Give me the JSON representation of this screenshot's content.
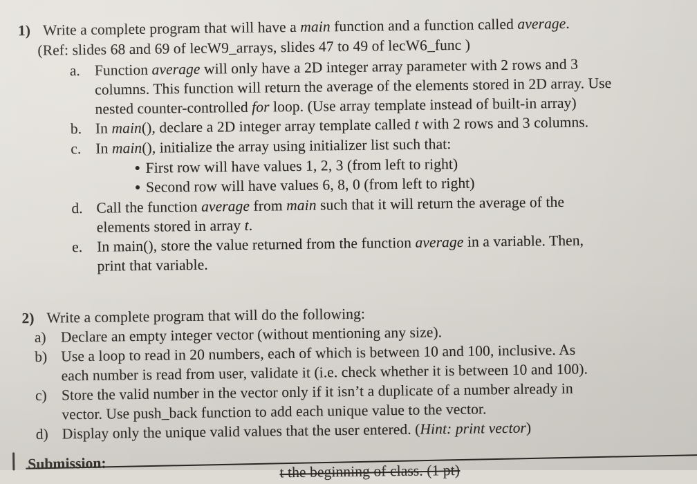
{
  "document": {
    "type": "printed-assignment-sheet",
    "paper_color": "#dedbd5",
    "ink_color": "#231f1d",
    "questions": [
      {
        "number": "1)",
        "lines": [
          {
            "text_before": "Write a complete program that will have a ",
            "italic": "main",
            "text_mid": " function and a function called ",
            "italic2": "average",
            "text_after": "."
          },
          {
            "text": "(Ref: slides 68 and 69 of lecW9_arrays, slides 47 to 49 of lecW6_func )"
          }
        ],
        "items": [
          {
            "marker": "a.",
            "lines": [
              {
                "pre": "Function ",
                "em": "average",
                "post": " will only have a 2D integer array parameter with 2 rows and 3"
              },
              {
                "pre": "columns. This function will return the average of the elements stored in 2D array. Use"
              },
              {
                "pre": "nested counter-controlled ",
                "em": "for",
                "post": " loop. (Use array template instead of built-in array)"
              }
            ]
          },
          {
            "marker": "b.",
            "lines": [
              {
                "pre": "In ",
                "em": "main",
                "post": "(), declare a 2D integer array template called ",
                "em2": "t",
                "post2": " with 2 rows and 3 columns."
              }
            ]
          },
          {
            "marker": "c.",
            "lines": [
              {
                "pre": "In ",
                "em": "main",
                "post": "(), initialize the array using initializer list such that:"
              }
            ],
            "bullets": [
              "First row will have values 1, 2, 3 (from left to right)",
              "Second row will have values 6, 8, 0 (from left to right)"
            ]
          },
          {
            "marker": "d.",
            "lines": [
              {
                "pre": "Call the function ",
                "em": "average",
                "post": " from ",
                "em2": "main",
                "post2": " such that it will return the average of the"
              },
              {
                "pre": "elements stored in array ",
                "em": "t",
                "post": "."
              }
            ]
          },
          {
            "marker": "e.",
            "lines": [
              {
                "pre": "In main(), store the value returned from the function ",
                "em": "average",
                "post": " in a variable. Then,"
              },
              {
                "pre": "print that variable."
              }
            ]
          }
        ]
      },
      {
        "number": "2)",
        "lines": [
          {
            "text": "Write a complete program that will do the following:"
          }
        ],
        "items": [
          {
            "marker": "a)",
            "lines": [
              {
                "pre": "Declare an empty integer vector (without mentioning any size)."
              }
            ]
          },
          {
            "marker": "b)",
            "lines": [
              {
                "pre": "Use a loop to read in 20 numbers, each of which is between 10 and 100, inclusive.  As"
              },
              {
                "pre": "each number is read from user, validate it (i.e. check whether it is between 10 and 100)."
              }
            ]
          },
          {
            "marker": "c)",
            "lines": [
              {
                "pre": "Store the valid number in the vector only if it isn’t a duplicate of a number already in"
              },
              {
                "pre": "vector. Use push_back function to add each unique value to the vector."
              }
            ]
          },
          {
            "marker": "d)",
            "lines": [
              {
                "pre": "Display only the unique valid values that the user entered. (",
                "em": "Hint: print vector",
                "post": ")"
              }
            ]
          }
        ]
      }
    ],
    "footer": {
      "heading": "Submission:",
      "clipped_line": "t the beginning of class. (1 pt)",
      "clipped_bold": "(1 pt)"
    }
  }
}
